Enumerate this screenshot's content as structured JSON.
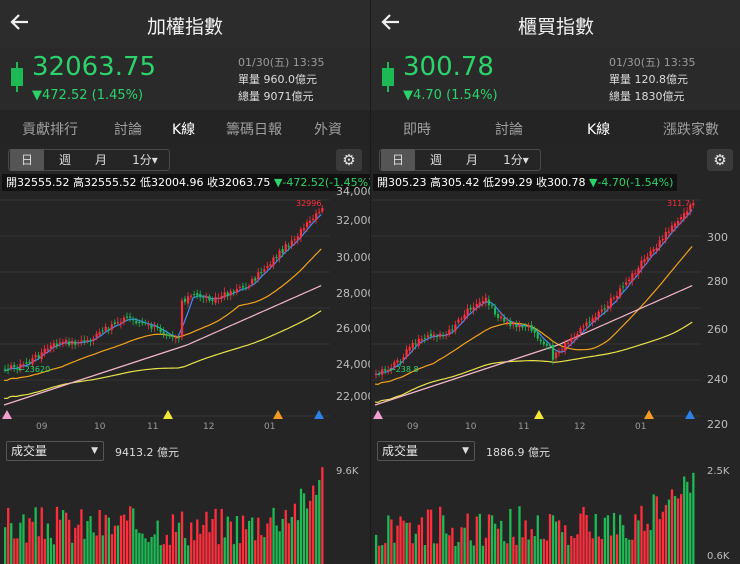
{
  "panels": [
    {
      "title": "加權指數",
      "price": "32063.75",
      "change": "472.52 (1.45%)",
      "time": "01/30(五) 13:35",
      "vol1": "單量 960.0億元",
      "vol2": "總量 9071億元",
      "tabs": [
        "貢獻排行",
        "討論",
        "K線",
        "籌碼日報",
        "外資"
      ],
      "active_tab": "K線",
      "periods": [
        "日",
        "週",
        "月",
        "1分"
      ],
      "ohlc": "開32555.52 高32555.52 低32004.96 收32063.75",
      "ohlc_change": "-472.52(-1.45%)",
      "yticks": [
        "34,000",
        "32,000",
        "30,000",
        "28,000",
        "26,000",
        "24,000",
        "22,000"
      ],
      "xticks": [
        "09",
        "10",
        "11",
        "12",
        "01"
      ],
      "high_label": "32996",
      "low_label": "23620",
      "vol_select": "成交量",
      "vol_value": "9413.2 億元",
      "vol_max": "9.6K",
      "vol_min": ""
    },
    {
      "title": "櫃買指數",
      "price": "300.78",
      "change": "4.70 (1.54%)",
      "time": "01/30(五) 13:35",
      "vol1": "單量 120.8億元",
      "vol2": "總量 1830億元",
      "tabs": [
        "即時",
        "討論",
        "K線",
        "漲跌家數"
      ],
      "active_tab": "K線",
      "periods": [
        "日",
        "週",
        "月",
        "1分"
      ],
      "ohlc": "開305.23 高305.42 低299.29 收300.78",
      "ohlc_change": "-4.70(-1.54%)",
      "yticks": [
        "300",
        "280",
        "260",
        "240",
        "220"
      ],
      "xticks": [
        "09",
        "10",
        "11",
        "12",
        "01"
      ],
      "high_label": "311.7",
      "low_label": "238.8",
      "vol_select": "成交量",
      "vol_value": "1886.9 億元",
      "vol_max": "2.5K",
      "vol_min": "0.6K"
    }
  ],
  "colors": {
    "up": "#ff2e3c",
    "down": "#1db954",
    "ma5": "#3b8eff",
    "ma20": "#f3a21b",
    "ma60": "#e6e24a",
    "ma120": "#f2b6c8"
  }
}
